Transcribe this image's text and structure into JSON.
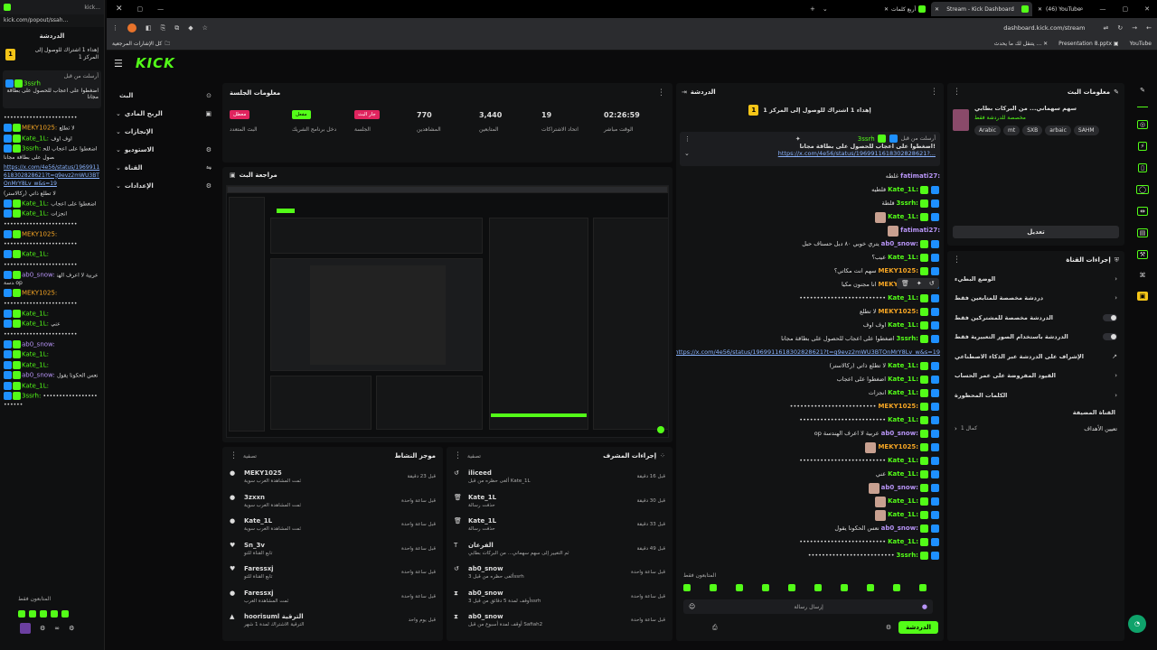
{
  "popout": {
    "url": "kick.com/popout/ssah...",
    "tab_title": "kick...",
    "title": "الدردشة",
    "pinned": "إهداء 1 اشتراك للوصول إلى المركز 1",
    "pinned_rank": "1",
    "pinned_msg_by": "أرسلت من قبل",
    "pinned_user": "3ssrh",
    "pinned_text": "اضغطوا على اعجاب للحصول على بطاقة مجانا",
    "messages": [
      {
        "user": "",
        "text": "•••••••••••••••••••••••"
      },
      {
        "user": "MEKY1025:",
        "text": "لا تطلع"
      },
      {
        "user": "Kate_1L:",
        "text": "اوف اوف"
      },
      {
        "user": "3ssrh:",
        "text": "اضغطوا على اعجاب للحصول على بطاقة مجانا"
      },
      {
        "user": "",
        "text": "https://x.com/4e56/status/1969911618302828621?t=g9evz2mWU3BTOnMrY8Lv_w&s=19"
      },
      {
        "user": "",
        "text": "لا تطلع ذاتي (ركالاستر)"
      },
      {
        "user": "Kate_1L:",
        "text": "اضغطوا على اعجاب"
      },
      {
        "user": "Kate_1L:",
        "text": "انجزات"
      },
      {
        "user": "",
        "text": "•••••••••••••••••••••••"
      },
      {
        "user": "MEKY1025:",
        "text": ""
      },
      {
        "user": "",
        "text": "•••••••••••••••••••••••"
      },
      {
        "user": "Kate_1L:",
        "text": ""
      },
      {
        "user": "",
        "text": "•••••••••••••••••••••••"
      },
      {
        "user": "ab0_snow:",
        "text": "عربية لا اعرف الهندسة op"
      },
      {
        "user": "MEKY1025:",
        "text": ""
      },
      {
        "user": "",
        "text": "•••••••••••••••••••••••"
      },
      {
        "user": "Kate_1L:",
        "text": ""
      },
      {
        "user": "Kate_1L:",
        "text": "عني"
      },
      {
        "user": "",
        "text": "•••••••••••••••••••••••"
      },
      {
        "user": "ab0_snow:",
        "text": ""
      },
      {
        "user": "Kate_1L:",
        "text": ""
      },
      {
        "user": "Kate_1L:",
        "text": ""
      },
      {
        "user": "ab0_snow:",
        "text": "نعس الحكونا يقول"
      },
      {
        "user": "Kate_1L:",
        "text": ""
      },
      {
        "user": "3ssrh:",
        "text": "•••••••••••••••••••••••"
      }
    ],
    "followers_only": "المتابعون فقط"
  },
  "browser": {
    "tabs": [
      {
        "label": "أربع كلمات"
      },
      {
        "label": "Stream - Kick Dashboard"
      },
      {
        "label": "(46) YouTube"
      }
    ],
    "url": "dashboard.kick.com/stream",
    "bookmarks_all": "كل الإشارات المرجعية",
    "bm1": "يتنقل لك ما يحدث ...",
    "bm2": "Presentation 8.pptx",
    "bm3": "YouTube"
  },
  "sidebar": {
    "logo": "KICK",
    "items": [
      {
        "label": "البث"
      },
      {
        "label": "الربح المادي"
      },
      {
        "label": "الإنجازات"
      },
      {
        "label": "الاستوديو"
      },
      {
        "label": "القناة"
      },
      {
        "label": "الإعدادات"
      }
    ]
  },
  "session": {
    "title": "معلومات الجلسة",
    "stats": [
      {
        "value": "02:26:59",
        "label": "الوقت مباشر"
      },
      {
        "value": "19",
        "label": "اتحاد الاشتراكات"
      },
      {
        "value": "3,440",
        "label": "المتابعين"
      },
      {
        "value": "770",
        "label": "المشاهدين"
      }
    ],
    "chips": [
      {
        "text": "معطل",
        "label": "البث المتعدد",
        "color": "#e0245e"
      },
      {
        "text": "مفعل",
        "label": "دخل برنامج الشريك",
        "color": "#53fc18"
      },
      {
        "text": "جار البث",
        "label": "الجلسة",
        "color": "#e0245e"
      }
    ]
  },
  "preview": {
    "title": "مراجعة البث",
    "kick": "KICK"
  },
  "activity": {
    "title": "موجز النشاط",
    "filter": "تصفية",
    "items": [
      {
        "name": "MEKY1025",
        "sub": "ثمت المشاهدة الغرب سوية",
        "time": "قبل 23 دقيقة"
      },
      {
        "name": "3zxxn",
        "sub": "ثمت المشاهدة الغرب سوية",
        "time": "قبل ساعة واحدة"
      },
      {
        "name": "Kate_1L",
        "sub": "ثمت المشاهدة الغرب سوية",
        "time": "قبل ساعة واحدة"
      },
      {
        "name": "Sn_3v",
        "sub": "تابع القناة للتو",
        "time": "قبل ساعة واحدة"
      },
      {
        "name": "Faressxj",
        "sub": "تابع القناة للتو",
        "time": "قبل ساعة واحدة"
      },
      {
        "name": "Faressxj",
        "sub": "ثمت المشاهدة الغرب",
        "time": "قبل ساعة واحدة"
      },
      {
        "name": "hoorisuml الترقية",
        "sub": "الترقية الاشتراك لمدة 1 شهر",
        "time": "قبل يوم واحد"
      }
    ]
  },
  "modactions": {
    "title": "إجراءات المشرف",
    "filter": "تصفية",
    "items": [
      {
        "name": "iliceed",
        "sub": "ألغى حظره من قبل Kate_1L",
        "time": "قبل 16 دقيقة"
      },
      {
        "name": "Kate_1L",
        "sub": "حذفت رسالة",
        "time": "قبل 30 دقيقة"
      },
      {
        "name": "Kate_1L",
        "sub": "حذفت رسالة",
        "time": "قبل 33 دقيقة"
      },
      {
        "name": "الفرعان",
        "sub": "ثم التغيير إلى سهم سهماني... من البركات بطابي",
        "time": "قبل 49 دقيقة"
      },
      {
        "name": "ab0_snow",
        "sub": "ألغى حظره من قبل 3ssrh",
        "time": "قبل ساعة واحدة"
      },
      {
        "name": "ab0_snow",
        "sub": "أوقف لمدة 5 دقائق من قبل 3ssrh",
        "time": "قبل ساعة واحدة"
      },
      {
        "name": "ab0_snow",
        "sub": "أوقف لمدة أسبوع من قبل Safiah2",
        "time": "قبل ساعة واحدة"
      }
    ]
  },
  "chat": {
    "title": "الدردشة",
    "pinned": "إهداء 1 اشتراك للوصول إلى المركز 1",
    "rank": "1",
    "pin_by": "أرسلت من قبل",
    "pin_user": "3ssrh",
    "pin_text": "اضغطوا على اعجاب للحصول على بطاقة مجانا!",
    "pin_link": "https://x.com/4e56/status/1969911618302828621?...",
    "messages": [
      {
        "user": "fatimati27:",
        "text": "غلطه",
        "c": "purple"
      },
      {
        "user": "Kate_1L:",
        "text": "قلطيه",
        "c": "green"
      },
      {
        "user": "3ssrh:",
        "text": "قلطة",
        "c": "green"
      },
      {
        "user": "Kate_1L:",
        "text": "",
        "c": "green"
      },
      {
        "user": "fatimati27:",
        "text": "",
        "c": "purple"
      },
      {
        "user": "ab0_snow:",
        "text": "يتري خوبي ٨٠ دبل حسناف حبل",
        "c": "purple"
      },
      {
        "user": "Kate_1L:",
        "text": "عيب؟",
        "c": "green"
      },
      {
        "user": "MEKY1025:",
        "text": "سهم انت مكاتي؟",
        "c": "orange"
      },
      {
        "user": "MEKY1025:",
        "text": "انا مجنون مكيا",
        "c": "orange"
      },
      {
        "user": "Kate_1L:",
        "text": "•••••••••••••••••••••••••",
        "c": "green"
      },
      {
        "user": "MEKY1025:",
        "text": "لا تطلع",
        "c": "orange"
      },
      {
        "user": "Kate_1L:",
        "text": "اوف اوف",
        "c": "green"
      },
      {
        "user": "3ssrh:",
        "text": "اضغطوا على اعجاب للحصول على بطاقة مجانا",
        "c": "green"
      },
      {
        "user": "",
        "text": "https://x.com/4e56/status/1969911618302828621?t=g9evz2mWU3BTOnMrY8Lv_w&s=19",
        "c": "link"
      },
      {
        "user": "Kate_1L:",
        "text": "لا تطلع ذاتي (ركالاستر)",
        "c": "green"
      },
      {
        "user": "Kate_1L:",
        "text": "اضغطوا على اعجاب",
        "c": "green"
      },
      {
        "user": "Kate_1L:",
        "text": "انجزات",
        "c": "green"
      },
      {
        "user": "MEKY1025:",
        "text": "•••••••••••••••••••••••••",
        "c": "orange"
      },
      {
        "user": "Kate_1L:",
        "text": "•••••••••••••••••••••••••",
        "c": "green"
      },
      {
        "user": "ab0_snow:",
        "text": "عربية لا اعرف الهندسة op",
        "c": "purple"
      },
      {
        "user": "MEKY1025:",
        "text": "",
        "c": "orange"
      },
      {
        "user": "Kate_1L:",
        "text": "•••••••••••••••••••••••••",
        "c": "green"
      },
      {
        "user": "Kate_1L:",
        "text": "عني",
        "c": "green"
      },
      {
        "user": "ab0_snow:",
        "text": "",
        "c": "purple"
      },
      {
        "user": "Kate_1L:",
        "text": "",
        "c": "green"
      },
      {
        "user": "Kate_1L:",
        "text": "",
        "c": "green"
      },
      {
        "user": "ab0_snow:",
        "text": "نعس الحكونا يقول",
        "c": "purple"
      },
      {
        "user": "Kate_1L:",
        "text": "•••••••••••••••••••••••••",
        "c": "green"
      },
      {
        "user": "3ssrh:",
        "text": "•••••••••••••••••••••••••",
        "c": "green"
      }
    ],
    "followers_only": "المتابعون فقط",
    "input_placeholder": "إرسال رسالة",
    "send": "الدردشة"
  },
  "streaminfo": {
    "title": "معلومات البث",
    "stream_title": "سهم سهماني... من البركات بطابي",
    "category": "مخصصة للدردشة فقط",
    "tags": [
      "Arabic",
      "mt",
      "SXB",
      "arbaic",
      "SAHM"
    ],
    "edit": "تعديل"
  },
  "channel": {
    "title": "إجراءات القناة",
    "items": [
      {
        "label": "الوضع البطيء",
        "type": "arrow"
      },
      {
        "label": "دردشة مخصصة للمتابعين فقط",
        "type": "arrow"
      },
      {
        "label": "الدردشة مخصصة للمشتركين فقط",
        "type": "toggle"
      },
      {
        "label": "الدردشة باستخدام الصور التعبيرية فقط",
        "type": "toggle"
      },
      {
        "label": "الإشراف على الدردشة عبر الذكاء الاصطناعي",
        "type": "ext"
      },
      {
        "label": "القيود المفروضة على عمر الحساب",
        "type": "arrow"
      },
      {
        "label": "الكلمات المحظورة",
        "type": "arrow"
      }
    ],
    "section": "القناة المضيفة",
    "target_label": "تعيين الأهداف",
    "target_val": "كمال 1"
  }
}
